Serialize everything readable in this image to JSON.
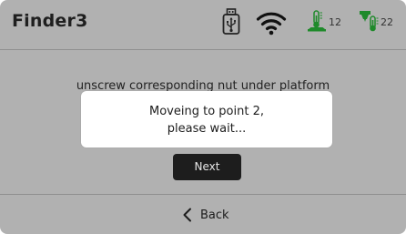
{
  "header": {
    "title": "Finder3",
    "icons": {
      "usb": "usb-icon",
      "wifi": "wifi-icon",
      "bed": "bed-temperature-icon",
      "nozzle": "nozzle-temperature-icon"
    },
    "bed_temp": "12",
    "nozzle_temp": "22"
  },
  "main": {
    "instruction": "unscrew corresponding nut under platform"
  },
  "modal": {
    "line1": "Moveing to point 2,",
    "line2": "please wait..."
  },
  "buttons": {
    "next_label": "Next",
    "back_label": "Back"
  },
  "colors": {
    "background": "#b1b1b1",
    "accent_green": "#1f8a2b",
    "button_dark": "#1d1d1d",
    "modal_bg": "#ffffff"
  }
}
